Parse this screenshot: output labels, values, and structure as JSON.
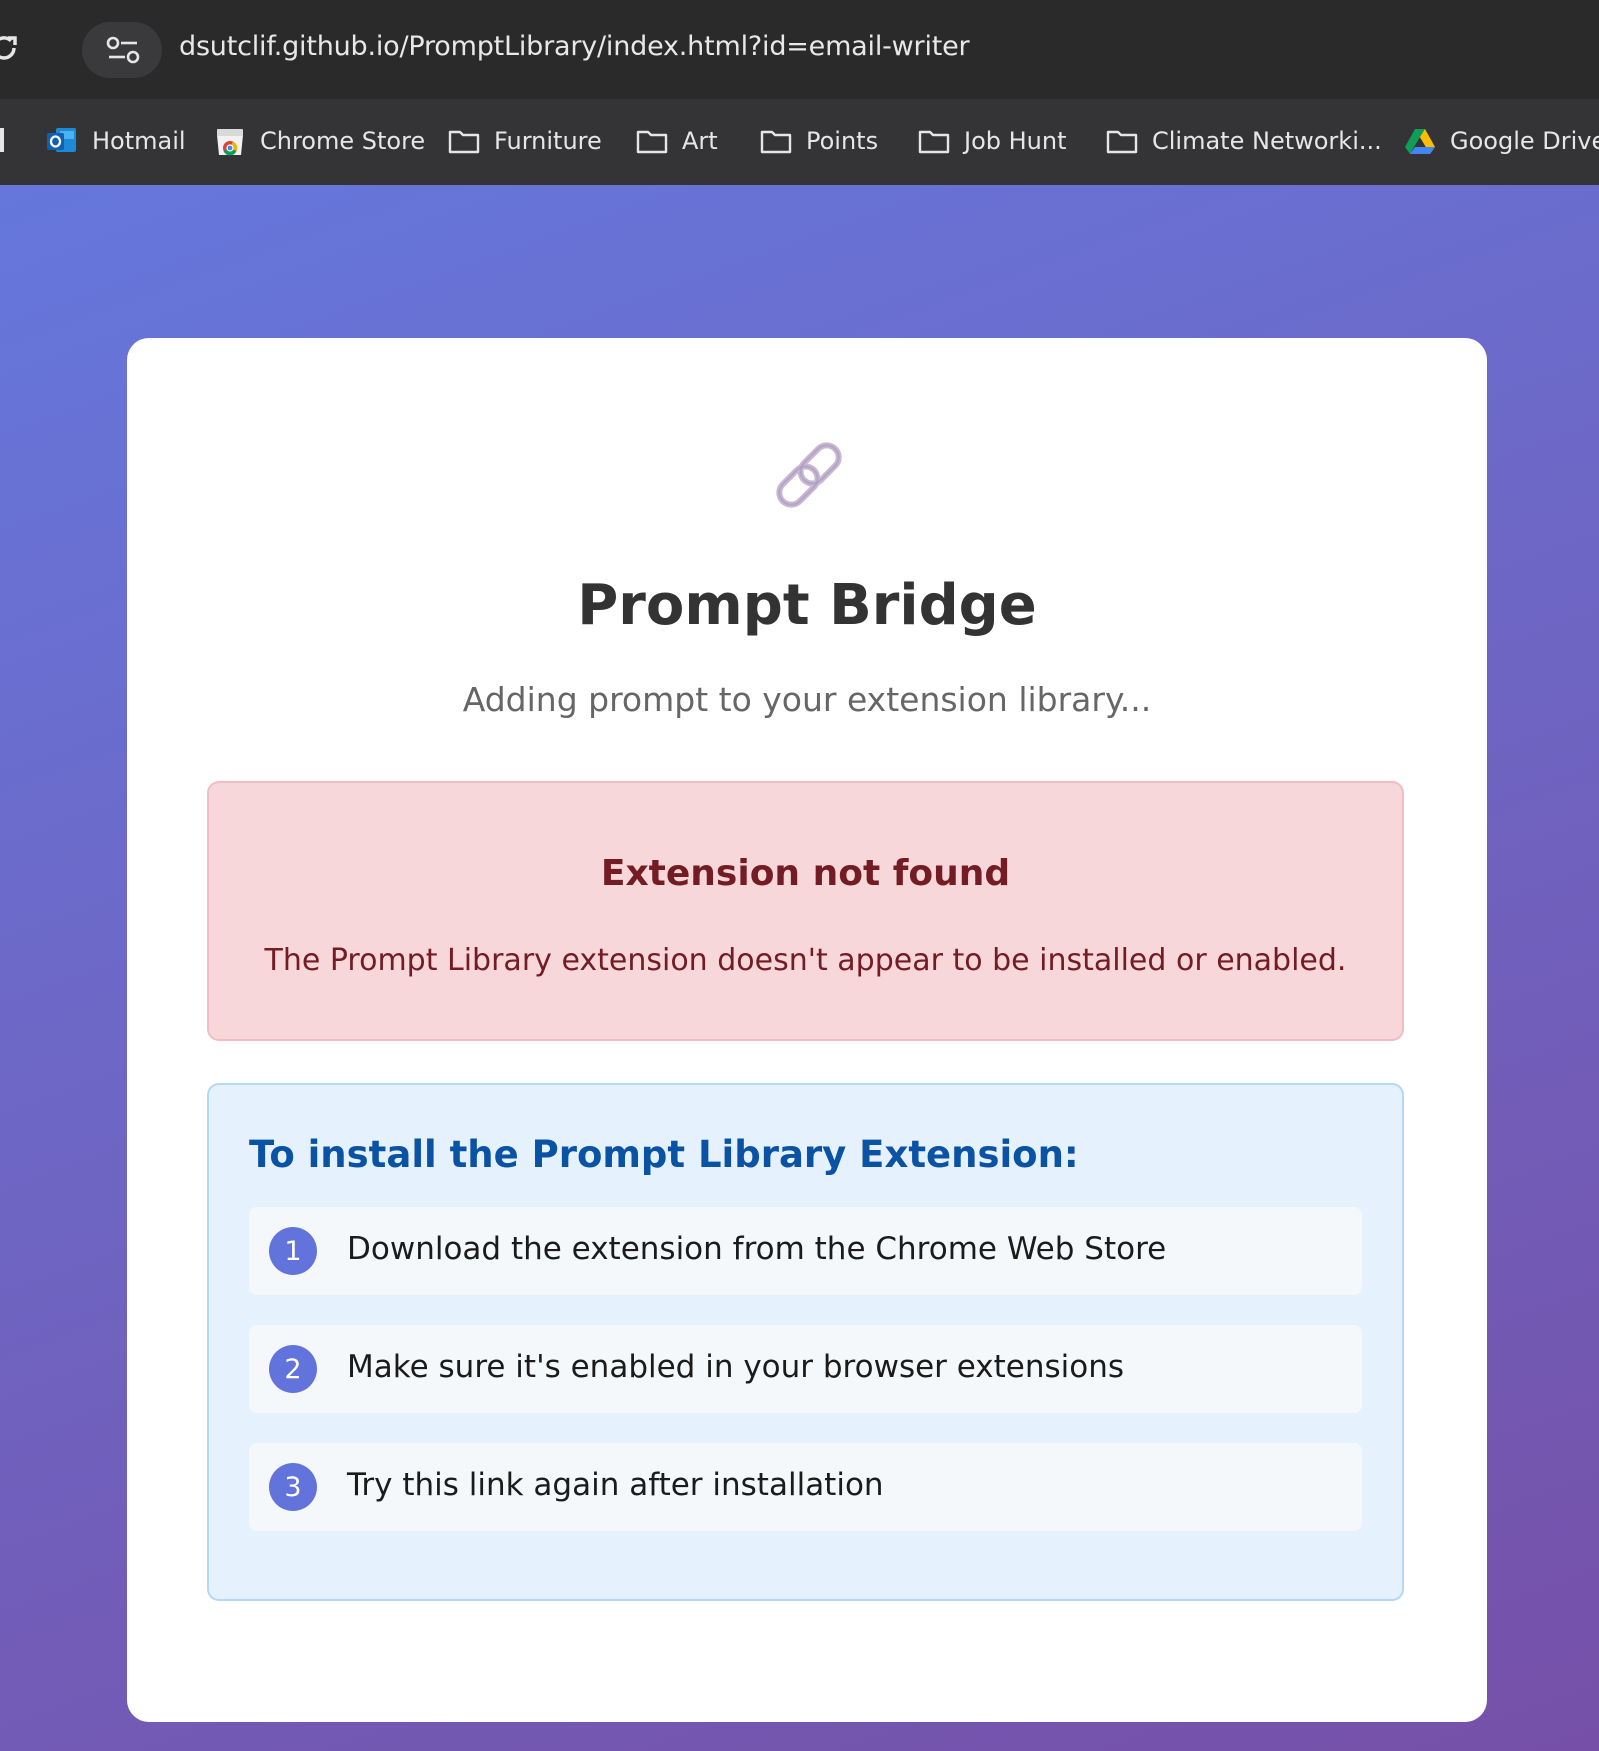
{
  "browser": {
    "url": "dsutclif.github.io/PromptLibrary/index.html?id=email-writer",
    "bookmarks": [
      {
        "label": "Hotmail",
        "icon": "outlook-icon"
      },
      {
        "label": "Chrome Store",
        "icon": "chrome-store-icon"
      },
      {
        "label": "Furniture",
        "icon": "folder-icon"
      },
      {
        "label": "Art",
        "icon": "folder-icon"
      },
      {
        "label": "Points",
        "icon": "folder-icon"
      },
      {
        "label": "Job Hunt",
        "icon": "folder-icon"
      },
      {
        "label": "Climate Networki...",
        "icon": "folder-icon"
      },
      {
        "label": "Google Drive",
        "icon": "google-drive-icon"
      }
    ]
  },
  "page": {
    "icon": "link-icon",
    "title": "Prompt Bridge",
    "subtitle": "Adding prompt to your extension library..."
  },
  "error": {
    "title": "Extension not found",
    "message": "The Prompt Library extension doesn't appear to be installed or enabled."
  },
  "install": {
    "title": "To install the Prompt Library Extension:",
    "steps": [
      {
        "num": "1",
        "text": "Download the extension from the Chrome Web Store"
      },
      {
        "num": "2",
        "text": "Make sure it's enabled in your browser extensions"
      },
      {
        "num": "3",
        "text": "Try this link again after installation"
      }
    ]
  },
  "colors": {
    "error_bg": "#f7d7da",
    "error_text": "#731c23",
    "install_bg": "#e5f1fd",
    "install_title": "#0a52a3",
    "step_badge": "#6274db"
  }
}
